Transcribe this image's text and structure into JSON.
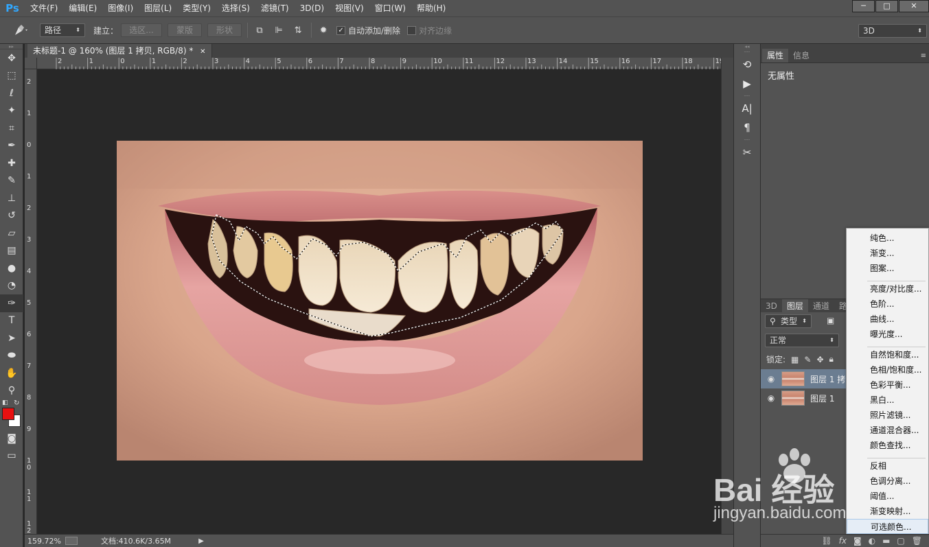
{
  "app": {
    "logo": "Ps"
  },
  "menu": [
    "文件(F)",
    "编辑(E)",
    "图像(I)",
    "图层(L)",
    "类型(Y)",
    "选择(S)",
    "滤镜(T)",
    "3D(D)",
    "视图(V)",
    "窗口(W)",
    "帮助(H)"
  ],
  "window_controls": {
    "minimize": "─",
    "restore": "□",
    "close": "✕"
  },
  "options": {
    "mode_select": "路径",
    "build_label": "建立：",
    "btn_selection": "选区...",
    "btn_mask": "蒙版",
    "btn_shape": "形状",
    "auto_add_delete": "自动添加/删除",
    "auto_add_checked": true,
    "align_edges": "对齐边缘",
    "workspace": "3D"
  },
  "document": {
    "tab_title": "未标题-1 @ 160% (图层 1 拷贝, RGB/8) *",
    "zoom": "159.72%",
    "doc_size": "文档:410.6K/3.65M",
    "ruler_top": [
      "2",
      "1",
      "0",
      "1",
      "2",
      "3",
      "4",
      "5",
      "6",
      "7",
      "8",
      "9",
      "10",
      "11",
      "12",
      "13",
      "14",
      "15",
      "16",
      "17",
      "18",
      "19"
    ],
    "ruler_left": [
      "2",
      "1",
      "0",
      "1",
      "2",
      "3",
      "4",
      "5",
      "6",
      "7",
      "8",
      "9",
      "1\n0",
      "1\n1",
      "1\n2"
    ]
  },
  "panels": {
    "props_tabs": [
      "属性",
      "信息"
    ],
    "props_text": "无属性",
    "layers_tabs": [
      "3D",
      "图层",
      "通道",
      "路"
    ],
    "filter_kind": "类型",
    "blend_mode": "正常",
    "lock_label": "锁定:",
    "layers": [
      {
        "name": "图层 1 拷",
        "selected": true
      },
      {
        "name": "图层 1",
        "selected": false
      }
    ],
    "bottom_icons": [
      "link-icon",
      "fx-icon",
      "mask-icon",
      "adjustment-icon",
      "folder-icon",
      "new-layer-icon",
      "trash-icon"
    ]
  },
  "context_menu": {
    "group1": [
      "纯色...",
      "渐变...",
      "图案..."
    ],
    "group2": [
      "亮度/对比度...",
      "色阶...",
      "曲线...",
      "曝光度..."
    ],
    "group3": [
      "自然饱和度...",
      "色相/饱和度...",
      "色彩平衡...",
      "黑白...",
      "照片滤镜...",
      "通道混合器...",
      "颜色查找..."
    ],
    "group4": [
      "反相",
      "色调分离...",
      "阈值...",
      "渐变映射...",
      "可选颜色..."
    ]
  },
  "watermark": {
    "text": "Bai 经验",
    "sub": "jingyan.baidu.com"
  },
  "colors": {
    "foreground": "#e81010",
    "background": "#ffffff",
    "accent": "#31a8ff"
  }
}
